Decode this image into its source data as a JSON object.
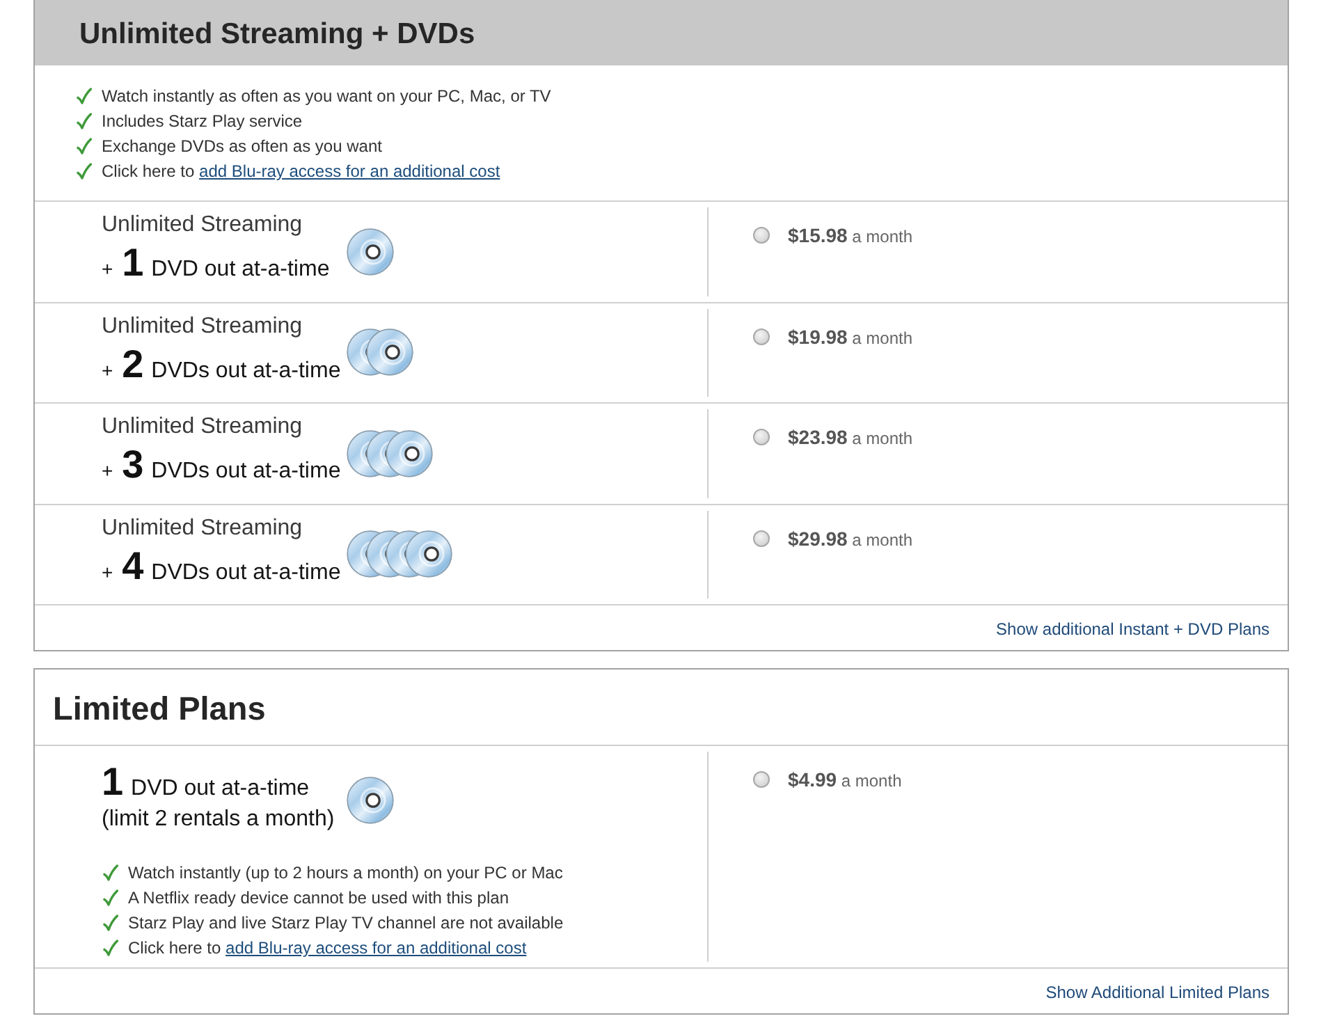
{
  "sections": [
    {
      "kind": "featured",
      "title": "Unlimited Streaming + DVDs",
      "features": [
        {
          "text": "Watch instantly as often as you want on your PC, Mac, or TV"
        },
        {
          "text": "Includes Starz Play service"
        },
        {
          "text": "Exchange DVDs as often as you want"
        },
        {
          "text": "Click here to",
          "link": "add Blu-ray access for an additional cost"
        }
      ],
      "plans": [
        {
          "name": "Unlimited Streaming",
          "prefix": "+",
          "count": "1",
          "unit": "DVD out at-a-time",
          "price": "**$15.98** a month",
          "selected": false
        },
        {
          "name": "Unlimited Streaming",
          "prefix": "+",
          "count": "2",
          "unit": "DVDs out at-a-time",
          "price": "**$19.98** a month",
          "selected": false
        },
        {
          "name": "Unlimited Streaming",
          "prefix": "+",
          "count": "3",
          "unit": "DVDs out at-a-time",
          "price": "**$23.98** a month",
          "selected": false
        },
        {
          "name": "Unlimited Streaming",
          "prefix": "+",
          "count": "4",
          "unit": "DVDs out at-a-time",
          "price": "**$29.98** a month",
          "selected": false
        }
      ],
      "more_link": "Show additional Instant + DVD Plans"
    },
    {
      "kind": "limited",
      "title": "Limited Plans",
      "plans": [
        {
          "count": "1",
          "unit": "DVD out at-a-time",
          "note": "(limit 2 rentals a month)",
          "price": "**$4.99** a month",
          "selected": false,
          "features": [
            {
              "text": "Watch instantly (up to 2 hours a month) on your PC or Mac"
            },
            {
              "text": "A Netflix ready device cannot be used with this plan"
            },
            {
              "text": "Starz Play and live Starz Play TV channel are not available"
            },
            {
              "text": "Click here to",
              "link": "add Blu-ray access for an additional cost"
            }
          ]
        }
      ],
      "more_link": "Show Additional Limited Plans"
    }
  ]
}
